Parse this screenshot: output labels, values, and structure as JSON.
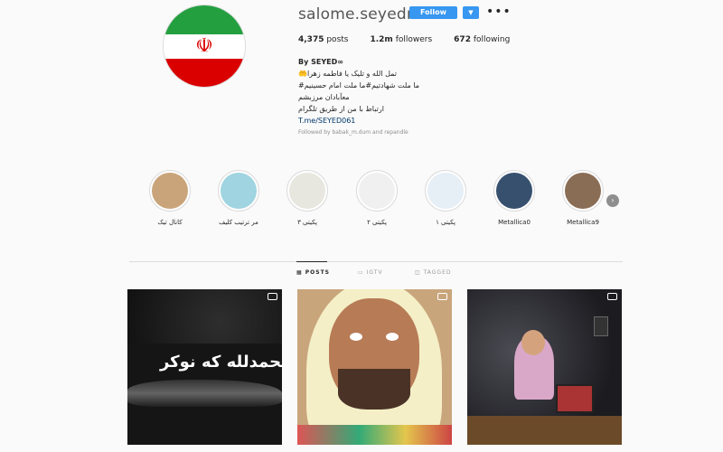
{
  "profile": {
    "username": "salome.seyednia",
    "follow_label": "Follow",
    "dropdown_icon": "chevron-down-icon",
    "more_icon": "ellipsis-icon",
    "stats": {
      "posts": "4,375",
      "posts_label": "posts",
      "followers": "1.2m",
      "followers_label": "followers",
      "following": "672",
      "following_label": "following"
    },
    "bio": {
      "name": "By SEYED∞",
      "line1": "🤲تمل الله و تلیک یا فاطمه زهرا",
      "line2": "#ما ملت شهادتیم#ما ملت امام حسینیم",
      "line3": "معآبادان مرزبشم",
      "line4": "ارتباط با من از طریق تلگرام",
      "link": "T.me/SEYED061",
      "followed_by": "Followed by babak_m.dum and repandle"
    }
  },
  "highlights": [
    {
      "label": "کانال تیک",
      "color": "#c9a47a"
    },
    {
      "label": "مر ترتیب کلیف",
      "color": "#9fd4e0"
    },
    {
      "label": "پکیتی ۳",
      "color": "#e7e7df"
    },
    {
      "label": "پکیتی ۲",
      "color": "#f0f0f0"
    },
    {
      "label": "پکیتی ۱",
      "color": "#e6eef6"
    },
    {
      "label": "Metallica0",
      "color": "#36506e"
    },
    {
      "label": "Metallica9",
      "color": "#8a6d55"
    }
  ],
  "tabs": [
    {
      "label": "POSTS",
      "active": true
    },
    {
      "label": "IGTV",
      "active": false
    },
    {
      "label": "TAGGED",
      "active": false
    }
  ],
  "posts": [
    {
      "text": "الحمدلله که نوکر"
    },
    {
      "text": ""
    },
    {
      "text": ""
    }
  ]
}
